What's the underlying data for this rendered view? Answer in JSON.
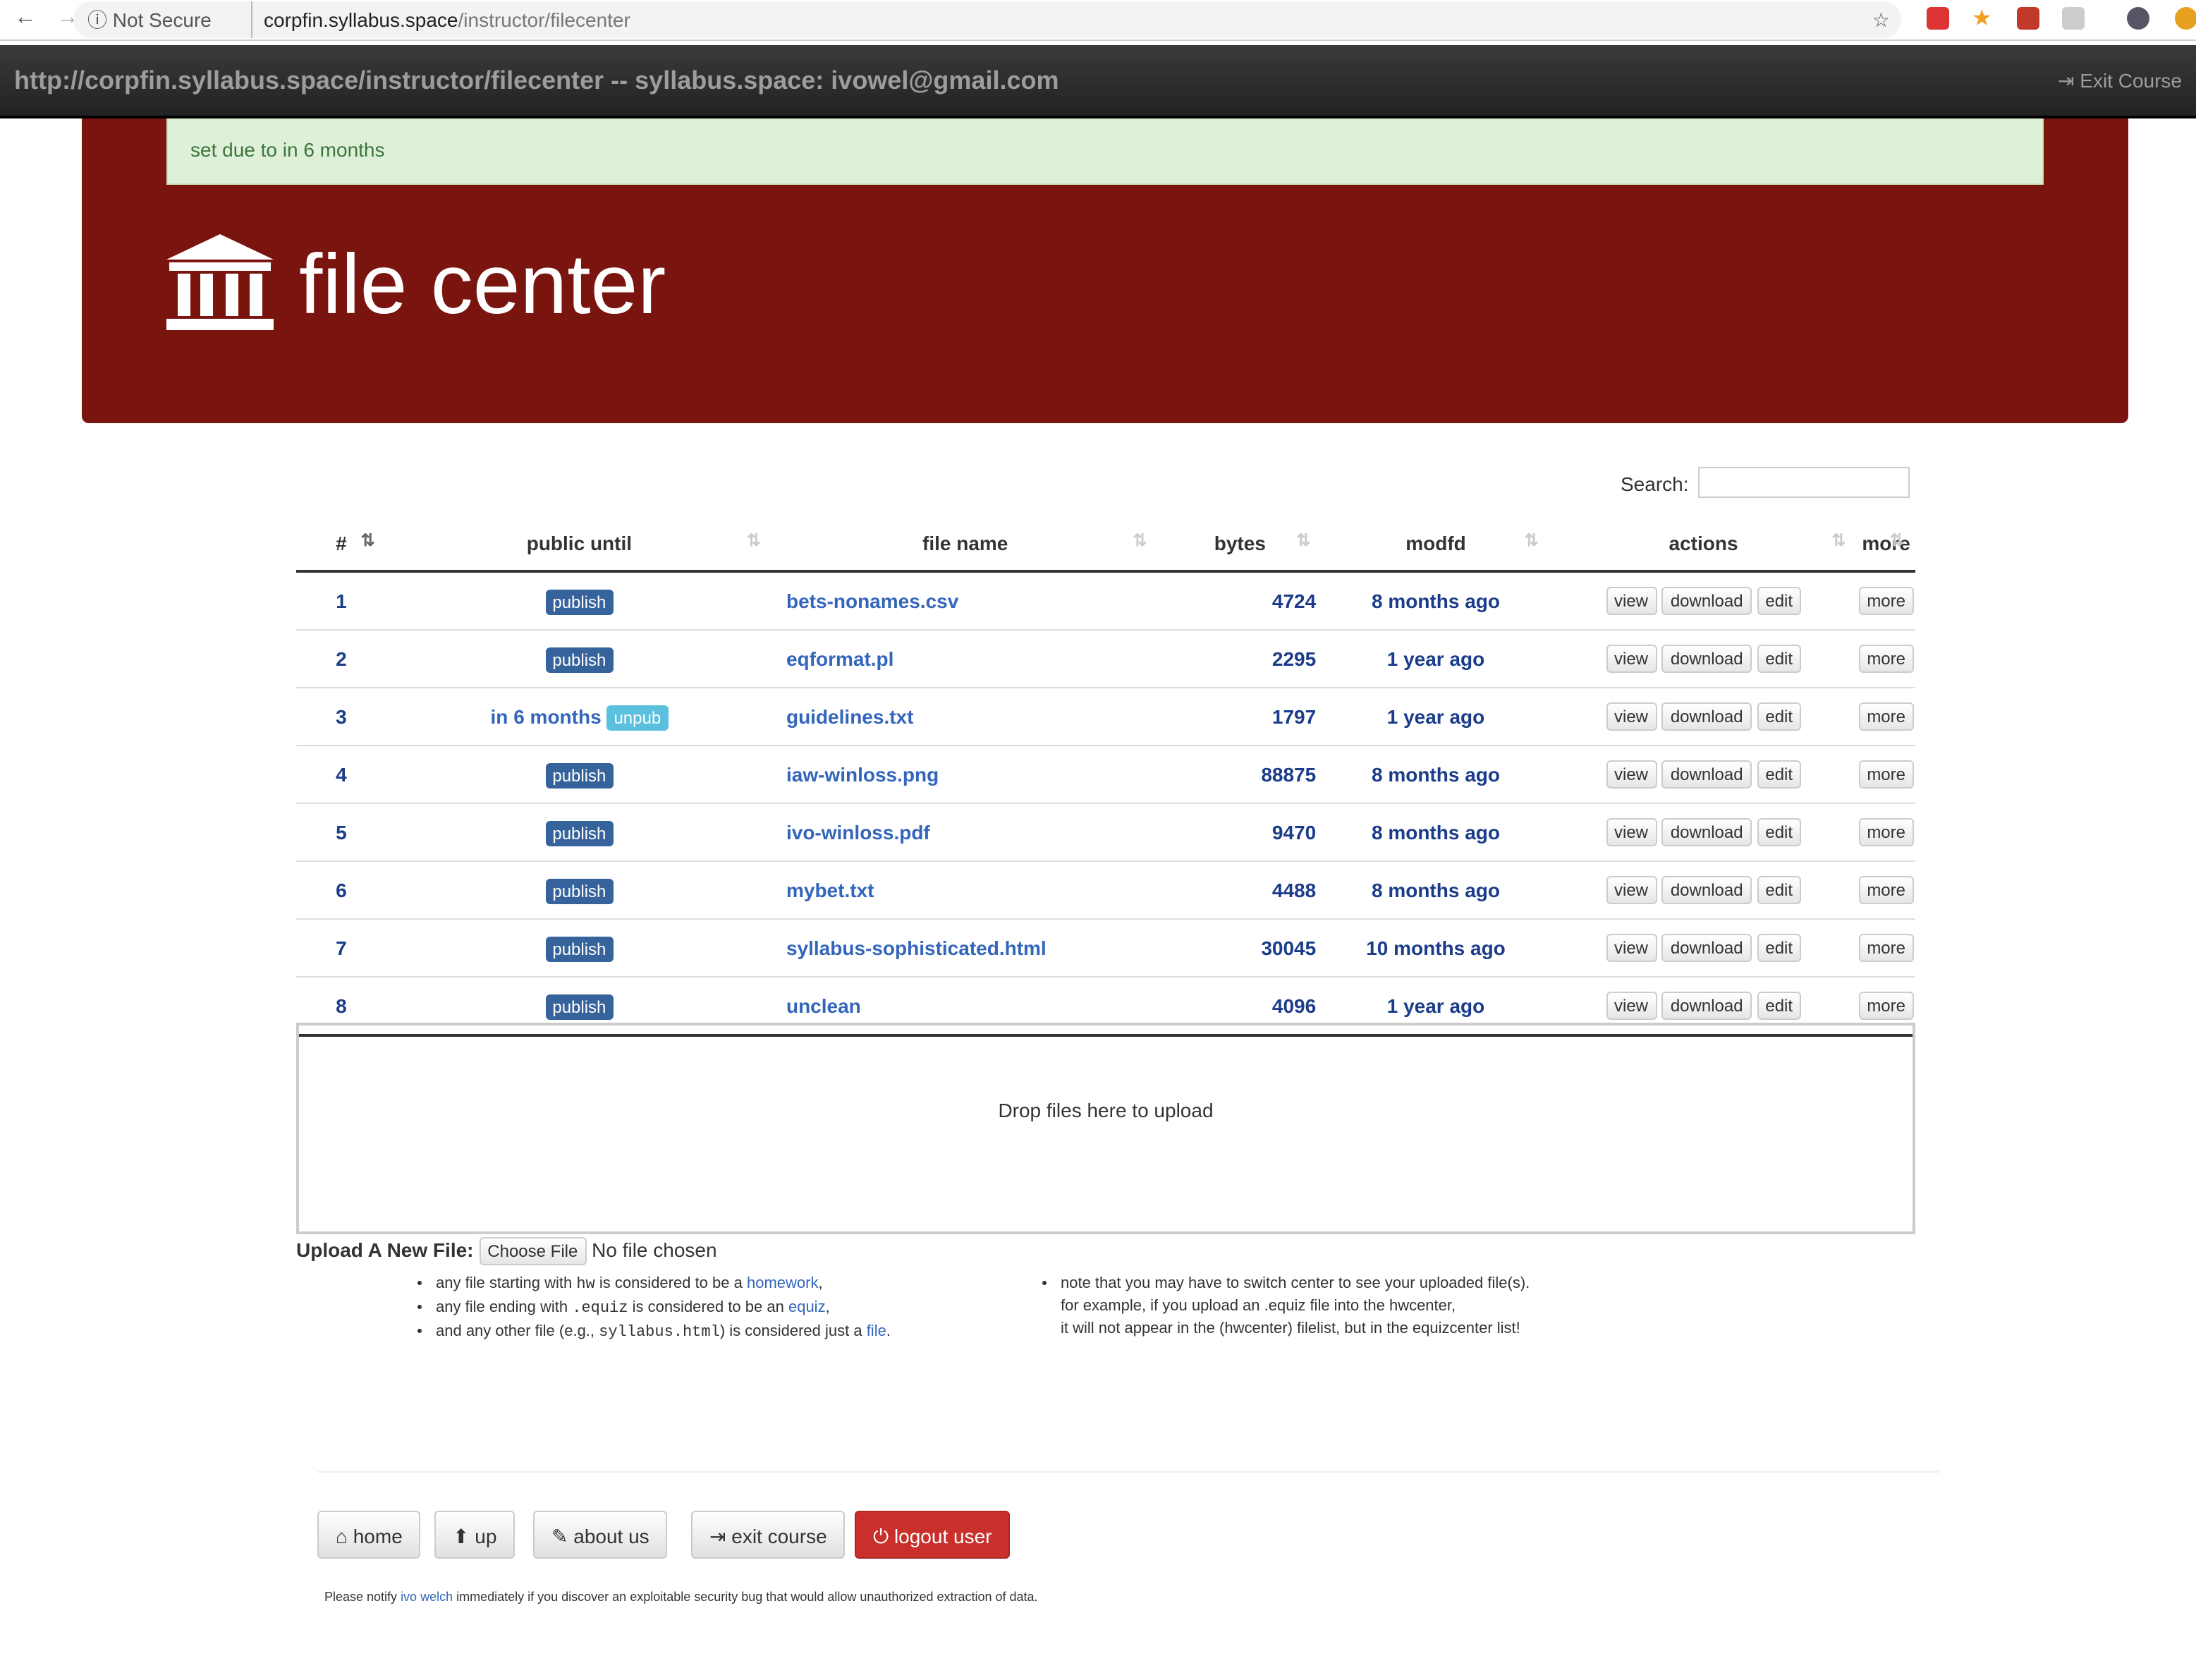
{
  "browser": {
    "security": "Not Secure",
    "url_host": "corpfin.syllabus.space",
    "url_path": "/instructor/filecenter"
  },
  "topbar": {
    "title": "http://corpfin.syllabus.space/instructor/filecenter -- syllabus.space: ivowel@gmail.com",
    "exit": "Exit Course"
  },
  "alert": "set due to in 6 months",
  "page_title": "file center",
  "search": {
    "label": "Search:",
    "value": ""
  },
  "columns": [
    "#",
    "public until",
    "file name",
    "bytes",
    "modfd",
    "actions",
    "more"
  ],
  "rows": [
    {
      "n": "1",
      "until": "",
      "btn": "publish",
      "name": "bets-nonames.csv",
      "bytes": "4724",
      "mod": "8 months ago"
    },
    {
      "n": "2",
      "until": "",
      "btn": "publish",
      "name": "eqformat.pl",
      "bytes": "2295",
      "mod": "1 year ago"
    },
    {
      "n": "3",
      "until": "in 6 months",
      "btn": "unpub",
      "name": "guidelines.txt",
      "bytes": "1797",
      "mod": "1 year ago"
    },
    {
      "n": "4",
      "until": "",
      "btn": "publish",
      "name": "iaw-winloss.png",
      "bytes": "88875",
      "mod": "8 months ago"
    },
    {
      "n": "5",
      "until": "",
      "btn": "publish",
      "name": "ivo-winloss.pdf",
      "bytes": "9470",
      "mod": "8 months ago"
    },
    {
      "n": "6",
      "until": "",
      "btn": "publish",
      "name": "mybet.txt",
      "bytes": "4488",
      "mod": "8 months ago"
    },
    {
      "n": "7",
      "until": "",
      "btn": "publish",
      "name": "syllabus-sophisticated.html",
      "bytes": "30045",
      "mod": "10 months ago"
    },
    {
      "n": "8",
      "until": "",
      "btn": "publish",
      "name": "unclean",
      "bytes": "4096",
      "mod": "1 year ago"
    }
  ],
  "actions": {
    "view": "view",
    "download": "download",
    "edit": "edit",
    "more": "more"
  },
  "drop": "Drop files here to upload",
  "upload": {
    "label": "Upload A New File:",
    "button": "Choose File",
    "status": "No file chosen"
  },
  "notes_left": [
    {
      "pre": "any file starting with ",
      "code": "hw",
      "mid": " is considered to be a ",
      "link": "homework",
      "post": ","
    },
    {
      "pre": "any file ending with ",
      "code": ".equiz",
      "mid": " is considered to be an ",
      "link": "equiz",
      "post": ","
    },
    {
      "pre": "and any other file (e.g., ",
      "code": "syllabus.html",
      "mid": ") is considered just a ",
      "link": "file",
      "post": "."
    }
  ],
  "notes_right": [
    "note that you may have to switch center to see your uploaded file(s).",
    "for example, if you upload an .equiz file into the hwcenter,",
    "it will not appear in the (hwcenter) filelist, but in the equizcenter list!"
  ],
  "footer": {
    "home": "home",
    "up": "up",
    "about": "about us",
    "exit": "exit course",
    "logout": "logout user",
    "notice_pre": "Please notify ",
    "notice_link": "ivo welch",
    "notice_post": " immediately if you discover an exploitable security bug that would allow unauthorized extraction of data."
  }
}
